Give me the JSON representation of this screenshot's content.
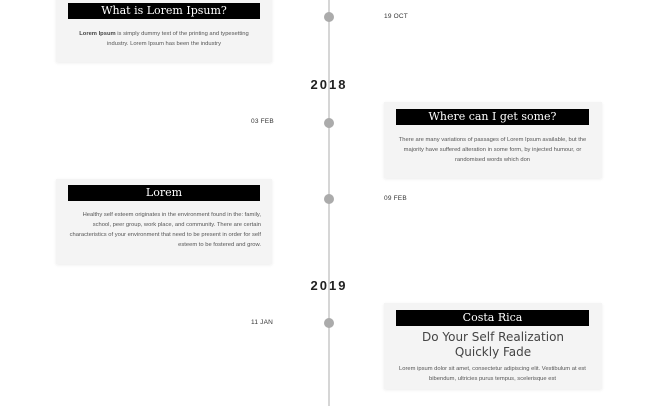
{
  "items": [
    {
      "title": "What is Lorem Ipsum?",
      "text_bold": "Lorem Ipsum",
      "text": " is simply dummy text of the printing and typesetting industry. Lorem Ipsum has been the industry",
      "date": "19 OCT"
    },
    {
      "title": "Where can I get some?",
      "text": "There are many variations of passages of Lorem Ipsum available, but the majority have suffered alteration in some form, by injected humour, or randomised words which don",
      "date": "03 FEB"
    },
    {
      "title": "Lorem",
      "text": "Healthy self esteem originates in the environment found in the: family, school, peer group, work place, and community. There are certain characteristics of your environment that need to be present in order for self esteem to be fostered and grow.",
      "date": "09 FEB"
    },
    {
      "title": "Costa Rica",
      "heading": "Do Your Self Realization Quickly Fade",
      "text": "Lorem ipsum dolor sit amet, consectetur adipiscing elit. Vestibulum at est bibendum, ultricies purus tempus, scelerisque est",
      "date": "11 JAN"
    }
  ],
  "years": [
    "2018",
    "2019"
  ]
}
